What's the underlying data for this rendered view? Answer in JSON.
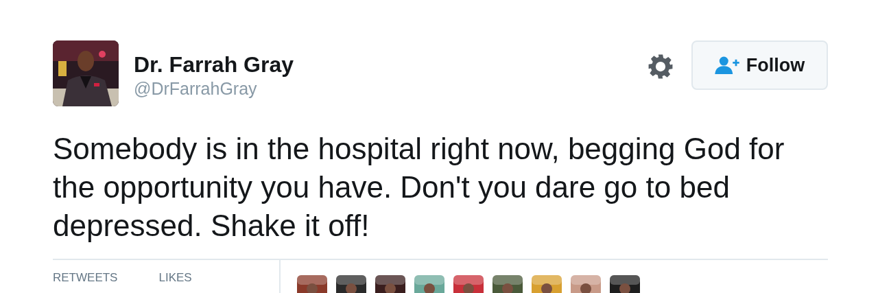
{
  "author": {
    "name": "Dr. Farrah Gray",
    "handle": "@DrFarrahGray"
  },
  "follow_button": {
    "label": "Follow"
  },
  "tweet": {
    "text": "Somebody is in the hospital right now, begging God for the opportunity you have. Don't you dare go to bed depressed. Shake it off!"
  },
  "stats": [
    {
      "label": "RETWEETS"
    },
    {
      "label": "LIKES"
    }
  ]
}
